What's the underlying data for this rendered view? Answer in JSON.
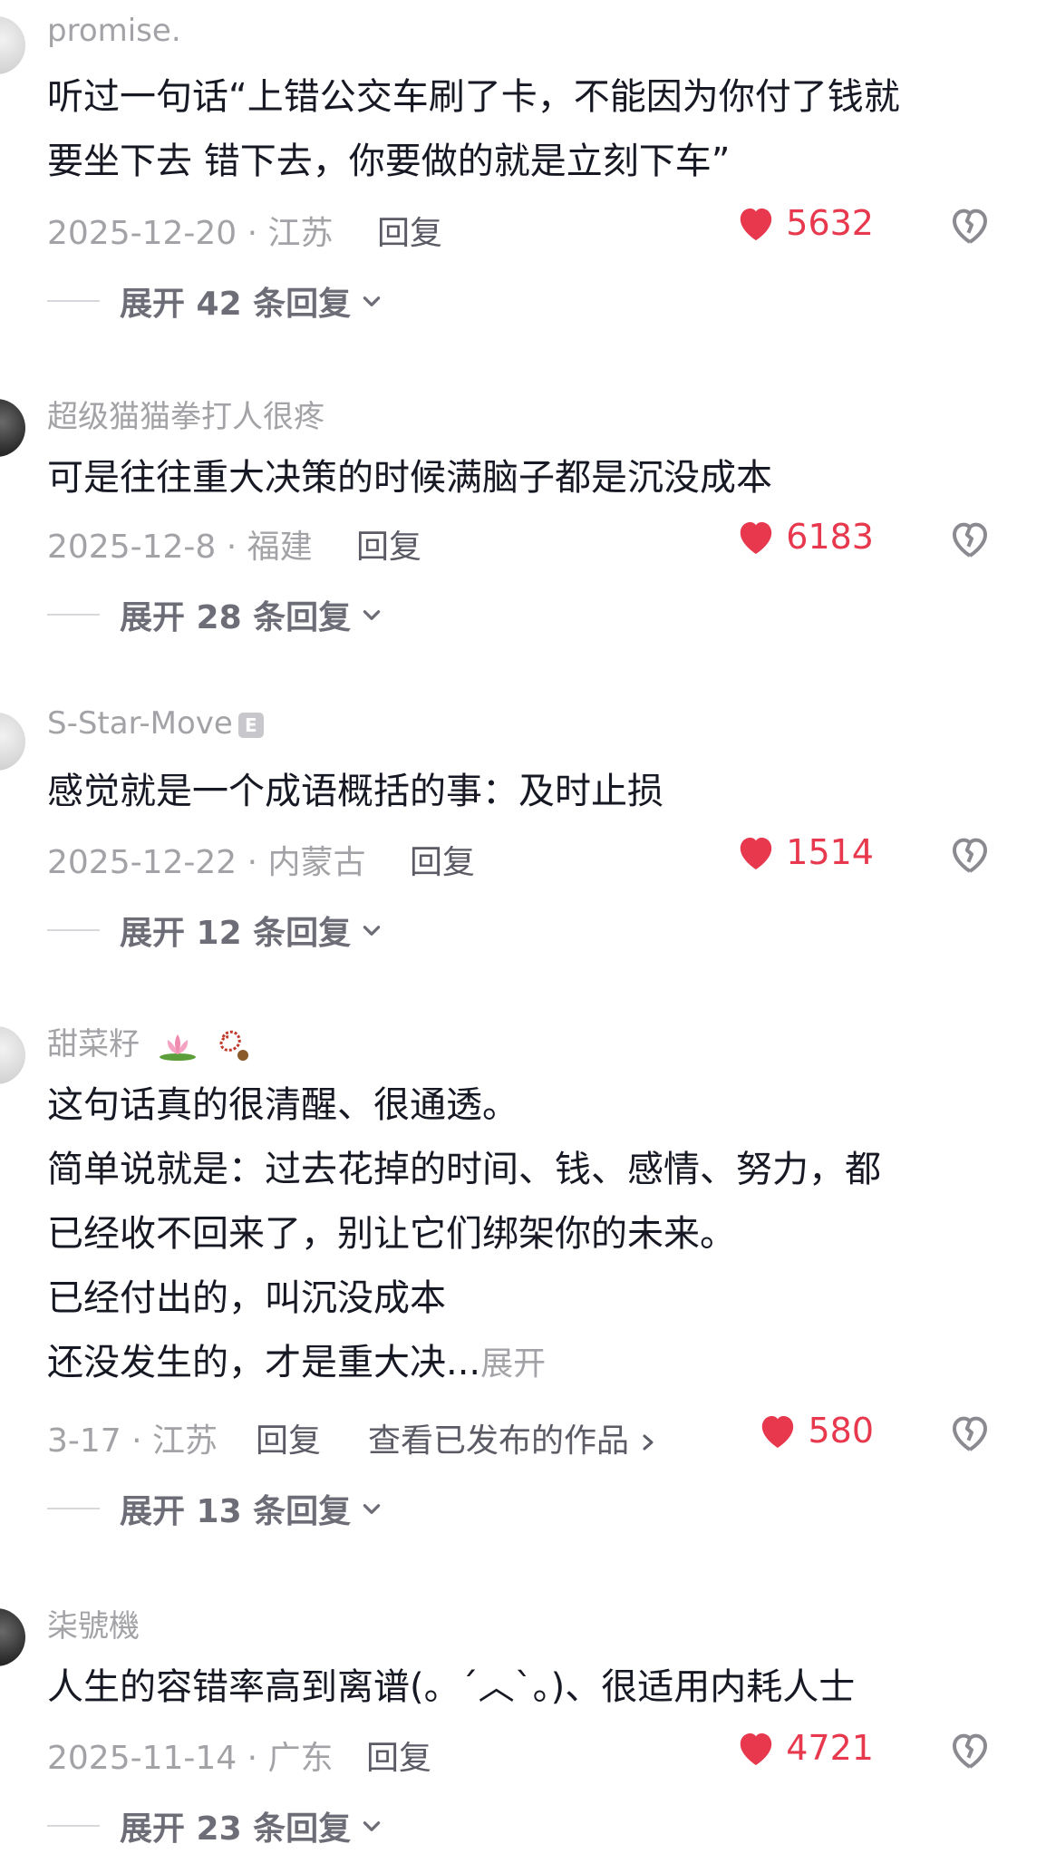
{
  "comments": [
    {
      "username": "promise.",
      "lines": [
        "听过一句话“上错公交车刷了卡，不能因为你付了钱就",
        "要坐下去 错下去，你要做的就是立刻下车”"
      ],
      "meta": "2025-12-20 · 江苏",
      "reply": "回复",
      "likes": "5632",
      "expand": "展开 42 条回复"
    },
    {
      "username": "超级猫猫拳打人很疼",
      "lines": [
        "可是往往重大决策的时候满脑子都是沉没成本"
      ],
      "meta": "2025-12-8 · 福建",
      "reply": "回复",
      "likes": "6183",
      "expand": "展开 28 条回复"
    },
    {
      "username": "S-Star-Move",
      "badge": "E",
      "lines": [
        "感觉就是一个成语概括的事：及时止损"
      ],
      "meta": "2025-12-22 · 内蒙古",
      "reply": "回复",
      "likes": "1514",
      "expand": "展开 12 条回复"
    },
    {
      "username": "甜菜籽",
      "lines": [
        "这句话真的很清醒、很通透。",
        "简单说就是：过去花掉的时间、钱、感情、努力，都",
        "已经收不回来了，别让它们绑架你的未来。",
        "已经付出的，叫沉没成本",
        "还没发生的，才是重大决..."
      ],
      "more": "展开",
      "meta": "3-17 · 江苏",
      "reply": "回复",
      "works": "查看已发布的作品",
      "likes": "580",
      "expand": "展开 13 条回复"
    },
    {
      "username": "柒號機",
      "lines": [
        "人生的容错率高到离谱(。´︿`。)、很适用内耗人士"
      ],
      "meta": "2025-11-14 · 广东",
      "reply": "回复",
      "likes": "4721",
      "expand": "展开 23 条回复"
    }
  ],
  "colors": {
    "like": "#e8384d",
    "meta": "#a3a3a7",
    "text": "#161823"
  },
  "icons": {
    "like": "heart-icon",
    "dislike": "broken-heart-icon",
    "expand": "chevron-down-icon",
    "works": "chevron-right-icon"
  }
}
